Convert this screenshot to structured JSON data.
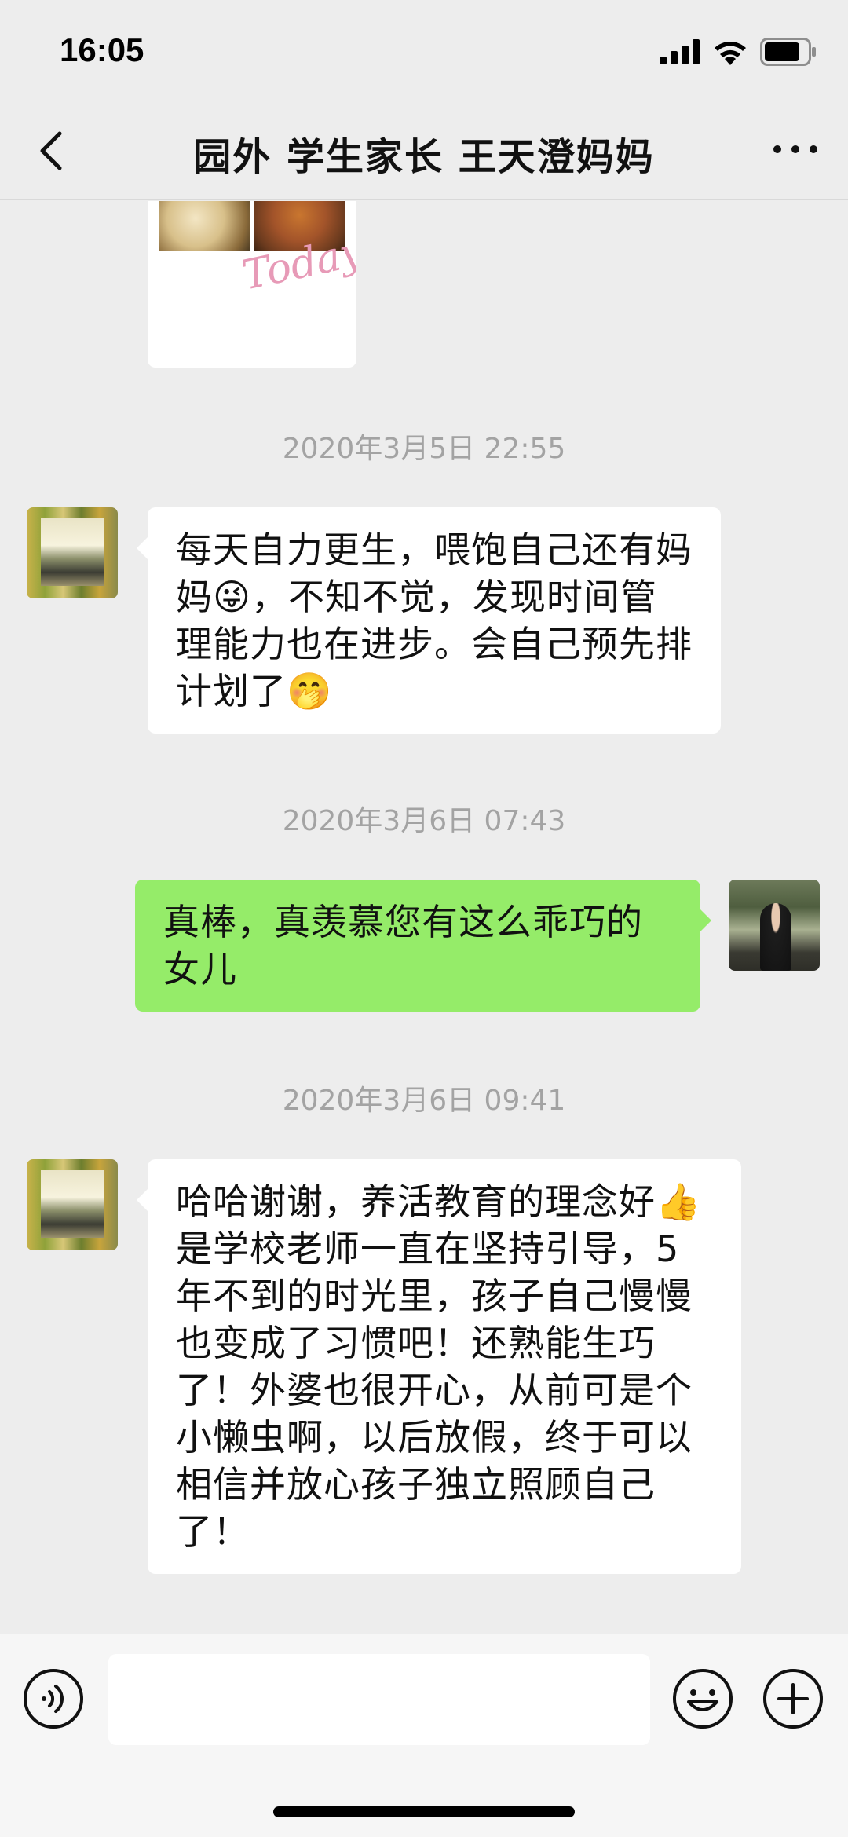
{
  "status_bar": {
    "time": "16:05"
  },
  "nav": {
    "title": "园外 学生家长 王天澄妈妈"
  },
  "image_message": {
    "overlay_text": "Today"
  },
  "messages": [
    {
      "timestamp": "2020年3月5日 22:55",
      "side": "left",
      "text": "每天自力更生，喂饱自己还有妈妈😜，不知不觉，发现时间管理能力也在进步。会自己预先排计划了🤭"
    },
    {
      "timestamp": "2020年3月6日 07:43",
      "side": "right",
      "text": "真棒，真羡慕您有这么乖巧的女儿"
    },
    {
      "timestamp": "2020年3月6日 09:41",
      "side": "left",
      "text": "哈哈谢谢，养活教育的理念好👍是学校老师一直在坚持引导，5年不到的时光里，孩子自己慢慢也变成了习惯吧！还熟能生巧了！外婆也很开心，从前可是个小懒虫啊，以后放假，终于可以相信并放心孩子独立照顾自己了！"
    }
  ],
  "input": {
    "value": ""
  },
  "icons": [
    "signal-icon",
    "wifi-icon",
    "battery-icon",
    "back-icon",
    "more-icon",
    "voice-icon",
    "emoji-icon",
    "plus-icon"
  ]
}
